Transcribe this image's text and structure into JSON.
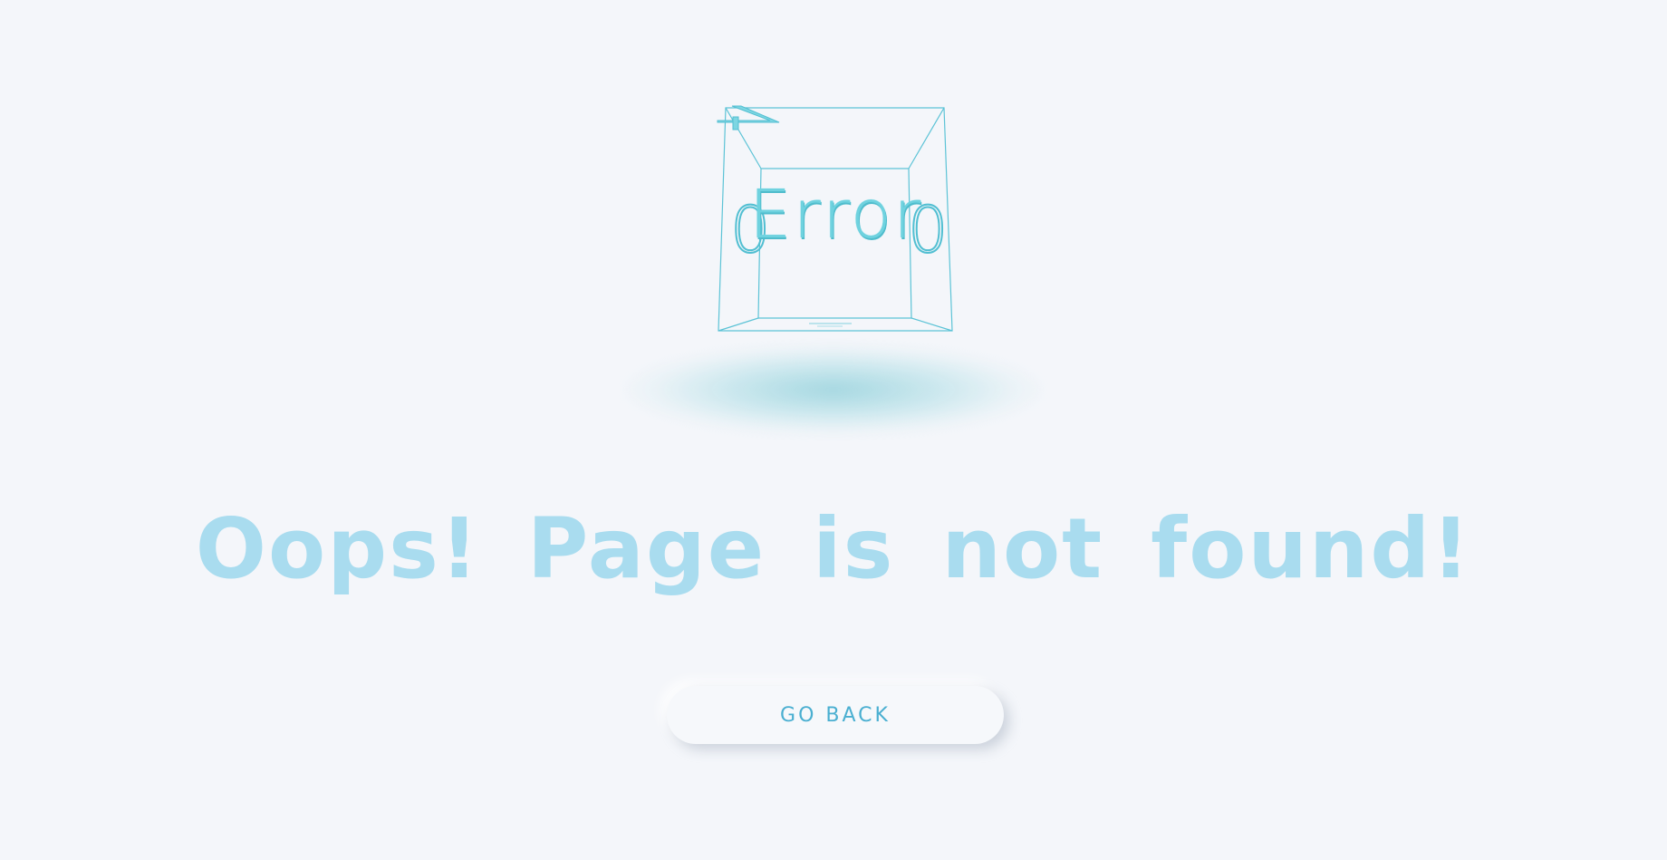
{
  "error_cube": {
    "face_text": "Error",
    "side_left_text": "0",
    "side_right_text": "0",
    "top_glyph": "4"
  },
  "headline": "Oops! Page is not  found!",
  "go_back_button": {
    "label": "GO BACK"
  },
  "colors": {
    "background": "#f4f6fa",
    "cube_line": "#5cc3d6",
    "headline": "#a9dcef",
    "button_text": "#4aafd1"
  }
}
